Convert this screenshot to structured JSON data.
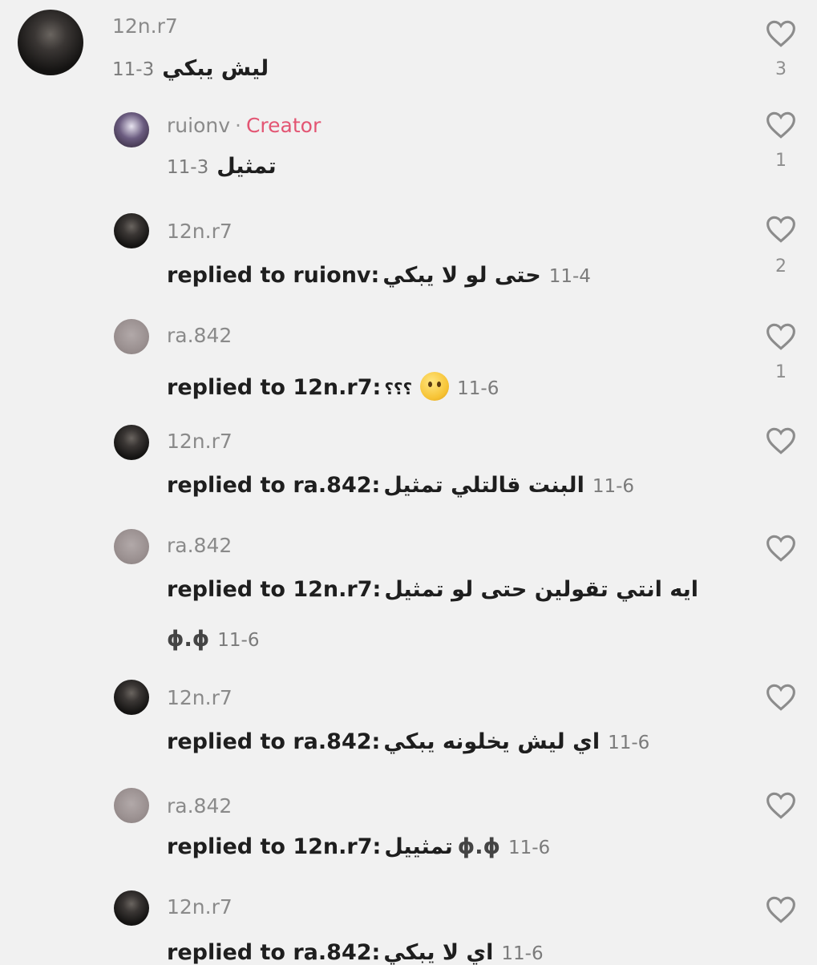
{
  "comments": [
    {
      "user": "12n.r7",
      "text": "ليش يبكي",
      "date": "11-3",
      "likes": "3"
    },
    {
      "user": "ruionv",
      "badge": "Creator",
      "separator": "·",
      "text": "تمثيل",
      "date": "11-3",
      "likes": "1"
    },
    {
      "user": "12n.r7",
      "reply_prefix": "replied to ruionv:",
      "text": "حتى لو لا يبكي",
      "date": "11-4",
      "likes": "2"
    },
    {
      "user": "ra.842",
      "reply_prefix": "replied to 12n.r7:",
      "text": "؟؟؟",
      "date": "11-6",
      "likes": "1"
    },
    {
      "user": "12n.r7",
      "reply_prefix": "replied to ra.842:",
      "text": "البنت قالتلي تمثيل",
      "date": "11-6",
      "likes": ""
    },
    {
      "user": "ra.842",
      "reply_prefix": "replied to 12n.r7:",
      "text": "ايه انتي تقولين حتى لو تمثيل",
      "face": "ϕ.ϕ",
      "date": "11-6",
      "likes": ""
    },
    {
      "user": "12n.r7",
      "reply_prefix": "replied to ra.842:",
      "text": "اي ليش يخلونه يبكي",
      "date": "11-6",
      "likes": ""
    },
    {
      "user": "ra.842",
      "reply_prefix": "replied to 12n.r7:",
      "text": "تمثييل",
      "face": "ϕ.ϕ",
      "date": "11-6",
      "likes": ""
    },
    {
      "user": "12n.r7",
      "reply_prefix": "replied to ra.842:",
      "text": "اي لا يبكي",
      "date": "11-6",
      "likes": ""
    }
  ],
  "icons": {
    "like": "heart-outline-icon",
    "emoji": "slightly-smiling-face-emoji"
  }
}
